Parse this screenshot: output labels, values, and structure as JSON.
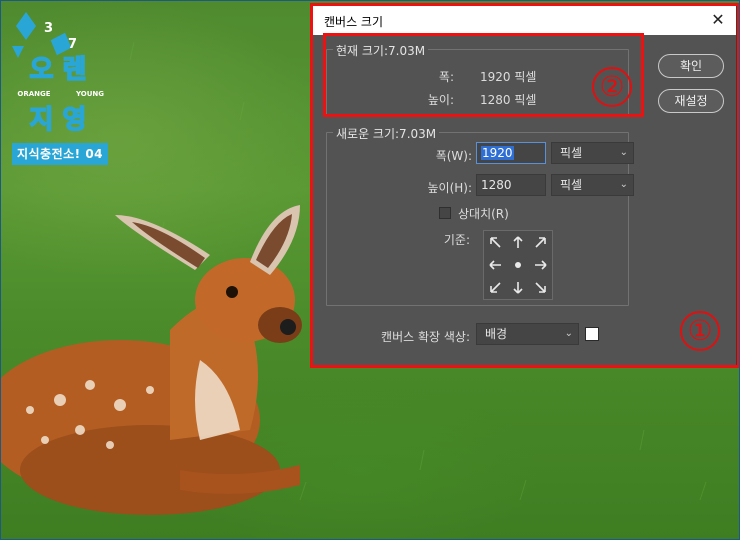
{
  "logo": {
    "num_left": "3",
    "num_right": "7",
    "line1": "오 렌",
    "orange": "ORANGE",
    "young": "YOUNG",
    "line2": "지 영",
    "tag": "지식충전소! 04"
  },
  "dialog": {
    "title": "캔버스 크기",
    "current_size": {
      "legend": "현재 크기:7.03M",
      "width_label": "폭:",
      "width_value": "1920 픽셀",
      "height_label": "높이:",
      "height_value": "1280 픽셀"
    },
    "new_size": {
      "legend": "새로운 크기:7.03M",
      "width_label": "폭(W):",
      "width_value": "1920",
      "width_unit": "픽셀",
      "height_label": "높이(H):",
      "height_value": "1280",
      "height_unit": "픽셀",
      "relative_label": "상대치(R)",
      "relative_checked": false,
      "anchor_label": "기준:"
    },
    "extension_color_label": "캔버스 확장 색상:",
    "extension_color_value": "배경",
    "extension_color_swatch": "#ffffff",
    "buttons": {
      "ok": "확인",
      "reset": "재설정"
    }
  },
  "annotations": {
    "circle_1": "①",
    "circle_2": "②",
    "color": "#ee1111"
  }
}
